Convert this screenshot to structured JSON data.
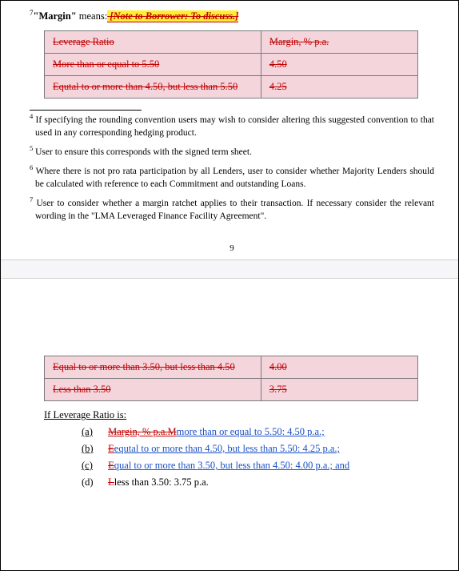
{
  "sup7": "7",
  "margin_label": "\"Margin\"",
  "means": " means:",
  "note": " [Note to Borrower: To discuss.]",
  "table1": {
    "r1c1": "Leverage Ratio",
    "r1c2": "Margin, % p.a.",
    "r2c1": "More than or equal to 5.50",
    "r2c2": "4.50",
    "r3c1": "Equtal to or more than 4.50, but less than 5.50",
    "r3c2": "4.25"
  },
  "fn4s": "4",
  "fn4": " If specifying the rounding convention users may wish to consider altering this suggested convention to that used in any corresponding hedging product.",
  "fn5s": "5",
  "fn5": " User to ensure this corresponds with the signed term sheet.",
  "fn6s": "6",
  "fn6": " Where there is not pro rata participation by all Lenders, user to consider whether Majority Lenders should be calculated with reference to each Commitment and outstanding Loans.",
  "fn7s": "7",
  "fn7": " User to consider whether a margin ratchet applies to their transaction.  If necessary consider the relevant wording in the \"LMA Leveraged Finance Facility Agreement\".",
  "page_num": "9",
  "table2": {
    "r1c1": "Equal to or more than 3.50, but less than 4.50",
    "r1c2": "4.00",
    "r2c1": "Less than 3.50",
    "r2c2": "3.75"
  },
  "intro": "If Leverage Ratio is:",
  "a_m": "(a)",
  "a_del": "Margin, % p.a.M",
  "a_ins": "more than or equal to 5.50: 4.50 p.a.;",
  "b_m": "(b)",
  "b_del": "E",
  "b_ins": "equtal to or more than 4.50, but less than 5.50: 4.25 p.a.;",
  "c_m": "(c)",
  "c_del": "E",
  "c_ins": "qual to or more than 3.50, but less than 4.50: 4.00 p.a.; and",
  "d_m": "(d)",
  "d_del": "L",
  "d_ins": "less than 3.50: 3.75 p.a."
}
